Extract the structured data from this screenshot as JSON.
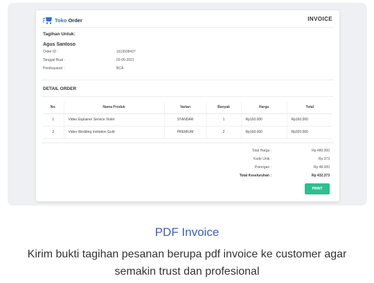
{
  "invoice": {
    "brand": {
      "name_part1": "Toko",
      "name_part2": "Order",
      "icon": "logo-icon"
    },
    "title": "INVOICE",
    "bill_to_label": "Tagihan Untuk:",
    "customer_name": "Agus Santoso",
    "meta": [
      {
        "label": "Order ID :",
        "value": "1619938427"
      },
      {
        "label": "Tanggal Buat :",
        "value": "02-05-2021"
      },
      {
        "label": "Pembayaran :",
        "value": "BCA"
      }
    ],
    "detail_title": "DETAIL ORDER",
    "table": {
      "headers": [
        "No.",
        "Nama Produk",
        "Varian",
        "Banyak",
        "Harga",
        "Total"
      ],
      "rows": [
        [
          "1",
          "Video Explainer Service Violet",
          "STANDAR",
          "1",
          "Rp160.000",
          "Rp160.000"
        ],
        [
          "2",
          "Video Wedding Invitation Gold",
          "PREMIUM",
          "2",
          "Rp160.000",
          "Rp320.000"
        ]
      ]
    },
    "summary": [
      {
        "label": "Total Harga :",
        "value": "Rp 480.000"
      },
      {
        "label": "Kode Unik :",
        "value": "Rp 373"
      },
      {
        "label": "Potongan :",
        "value": "Rp 48.000"
      },
      {
        "label": "Total Keseluruhan :",
        "value": "Rp 432.373"
      }
    ],
    "print_label": "PRINT",
    "colors": {
      "brand_blue": "#2c6fd6",
      "print_green": "#2ebf8e"
    }
  },
  "caption": {
    "title": "PDF Invoice",
    "desc_line1": "Kirim bukti tagihan pesanan berupa pdf invoice ke customer agar",
    "desc_line2": "semakin trust dan profesional",
    "title_color": "#3d5bc4"
  }
}
